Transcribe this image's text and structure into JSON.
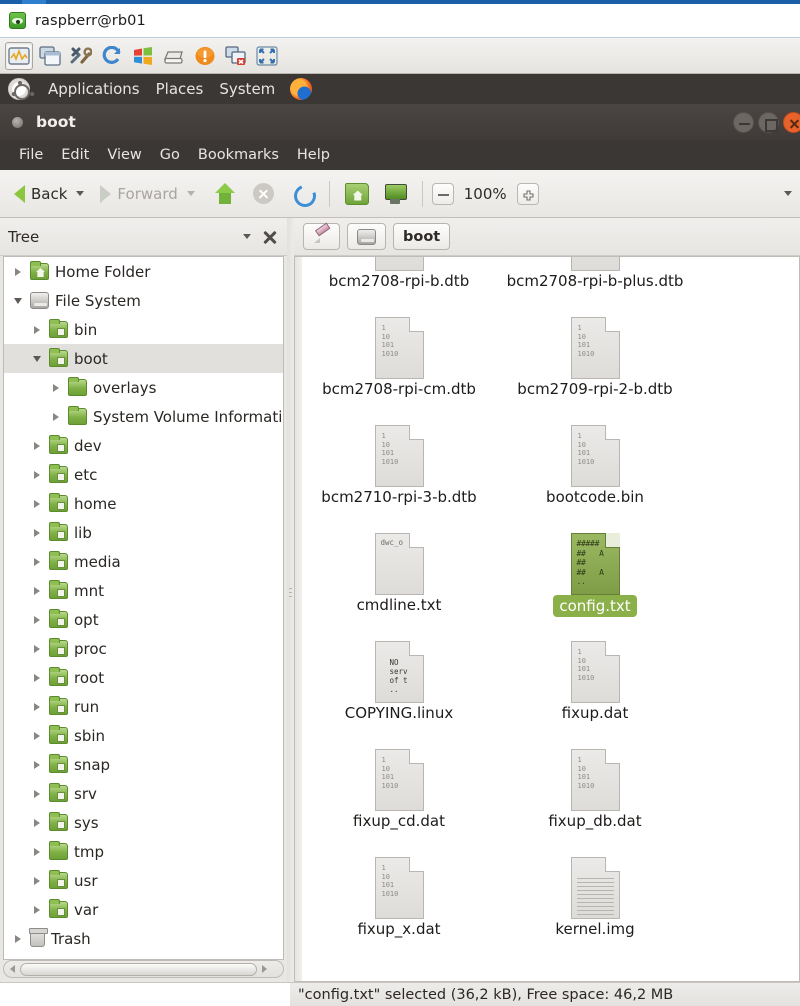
{
  "vnc": {
    "window_title": "raspberr@rb01",
    "icon": "vnc-eye-icon",
    "toolbar": [
      {
        "name": "connection-options-icon",
        "label": "Connection options"
      },
      {
        "name": "new-window-icon",
        "label": "New window"
      },
      {
        "name": "tools-icon",
        "label": "Options"
      },
      {
        "name": "refresh-icon",
        "label": "Refresh screen"
      },
      {
        "name": "send-ctrl-alt-del-icon",
        "label": "Send Ctrl-Alt-Del"
      },
      {
        "name": "file-transfer-icon",
        "label": "Transfer files"
      },
      {
        "name": "info-icon",
        "label": "Connection info"
      },
      {
        "name": "disconnect-icon",
        "label": "Disconnect"
      },
      {
        "name": "fullscreen-icon",
        "label": "Full screen"
      }
    ]
  },
  "gnome_panel": {
    "logo": "ubuntu-logo-icon",
    "menus": [
      "Applications",
      "Places",
      "System"
    ],
    "launchers": [
      {
        "name": "firefox-icon",
        "label": "Firefox"
      }
    ]
  },
  "nautilus": {
    "title": "boot",
    "menubar": [
      "File",
      "Edit",
      "View",
      "Go",
      "Bookmarks",
      "Help"
    ],
    "window_controls": [
      {
        "name": "minimize-button",
        "label": "Minimize"
      },
      {
        "name": "maximize-button",
        "label": "Maximize"
      },
      {
        "name": "close-button",
        "label": "Close"
      }
    ],
    "nav": {
      "back_label": "Back",
      "forward_label": "Forward",
      "up_label": "Up",
      "stop_label": "Stop",
      "reload_label": "Reload",
      "home_label": "Home",
      "computer_label": "Computer",
      "zoom_out_label": "Zoom out",
      "zoom_level": "100%",
      "zoom_in_label": "Zoom in"
    },
    "path_bar": {
      "edit_label": "Toggle location entry",
      "root_label": "File System",
      "crumbs": [
        "boot"
      ]
    },
    "status": "\"config.txt\" selected (36,2 kB), Free space: 46,2 MB"
  },
  "tree": {
    "header_title": "Tree",
    "items": [
      {
        "label": "Home Folder",
        "indent": 0,
        "state": "collapsed",
        "icon": "home-folder-icon",
        "selected": false
      },
      {
        "label": "File System",
        "indent": 0,
        "state": "expanded",
        "icon": "drive-icon",
        "selected": false
      },
      {
        "label": "bin",
        "indent": 1,
        "state": "collapsed",
        "icon": "folder-icon",
        "selected": false
      },
      {
        "label": "boot",
        "indent": 1,
        "state": "expanded",
        "icon": "folder-icon",
        "selected": true
      },
      {
        "label": "overlays",
        "indent": 2,
        "state": "collapsed",
        "icon": "folder-plain-icon",
        "selected": false
      },
      {
        "label": "System Volume Informati",
        "indent": 2,
        "state": "collapsed",
        "icon": "folder-plain-icon",
        "selected": false
      },
      {
        "label": "dev",
        "indent": 1,
        "state": "collapsed",
        "icon": "folder-icon",
        "selected": false
      },
      {
        "label": "etc",
        "indent": 1,
        "state": "collapsed",
        "icon": "folder-icon",
        "selected": false
      },
      {
        "label": "home",
        "indent": 1,
        "state": "collapsed",
        "icon": "folder-icon",
        "selected": false
      },
      {
        "label": "lib",
        "indent": 1,
        "state": "collapsed",
        "icon": "folder-icon",
        "selected": false
      },
      {
        "label": "media",
        "indent": 1,
        "state": "collapsed",
        "icon": "folder-icon",
        "selected": false
      },
      {
        "label": "mnt",
        "indent": 1,
        "state": "collapsed",
        "icon": "folder-icon",
        "selected": false
      },
      {
        "label": "opt",
        "indent": 1,
        "state": "collapsed",
        "icon": "folder-icon",
        "selected": false
      },
      {
        "label": "proc",
        "indent": 1,
        "state": "collapsed",
        "icon": "folder-icon",
        "selected": false
      },
      {
        "label": "root",
        "indent": 1,
        "state": "collapsed",
        "icon": "folder-icon",
        "selected": false
      },
      {
        "label": "run",
        "indent": 1,
        "state": "collapsed",
        "icon": "folder-icon",
        "selected": false
      },
      {
        "label": "sbin",
        "indent": 1,
        "state": "collapsed",
        "icon": "folder-icon",
        "selected": false
      },
      {
        "label": "snap",
        "indent": 1,
        "state": "collapsed",
        "icon": "folder-icon",
        "selected": false
      },
      {
        "label": "srv",
        "indent": 1,
        "state": "collapsed",
        "icon": "folder-icon",
        "selected": false
      },
      {
        "label": "sys",
        "indent": 1,
        "state": "collapsed",
        "icon": "folder-icon",
        "selected": false
      },
      {
        "label": "tmp",
        "indent": 1,
        "state": "collapsed",
        "icon": "folder-plain-icon",
        "selected": false
      },
      {
        "label": "usr",
        "indent": 1,
        "state": "collapsed",
        "icon": "folder-icon",
        "selected": false
      },
      {
        "label": "var",
        "indent": 1,
        "state": "collapsed",
        "icon": "folder-icon",
        "selected": false
      },
      {
        "label": "Trash",
        "indent": 0,
        "state": "collapsed",
        "icon": "trash-icon",
        "selected": false
      }
    ]
  },
  "files": {
    "icon_bits": "1\n10\n101\n1010",
    "items": [
      {
        "name": "bcm2708-rpi-b.dtb",
        "icon": "binary-file-icon",
        "selected": false,
        "col": 0,
        "row": 0
      },
      {
        "name": "bcm2708-rpi-b-plus.dtb",
        "icon": "binary-file-icon",
        "selected": false,
        "col": 1,
        "row": 0
      },
      {
        "name": "bcm2708-rpi-cm.dtb",
        "icon": "binary-file-icon",
        "selected": false,
        "col": 0,
        "row": 1
      },
      {
        "name": "bcm2709-rpi-2-b.dtb",
        "icon": "binary-file-icon",
        "selected": false,
        "col": 1,
        "row": 1
      },
      {
        "name": "bcm2710-rpi-3-b.dtb",
        "icon": "binary-file-icon",
        "selected": false,
        "col": 0,
        "row": 2
      },
      {
        "name": "bootcode.bin",
        "icon": "binary-file-icon",
        "selected": false,
        "col": 1,
        "row": 2
      },
      {
        "name": "cmdline.txt",
        "icon": "text-file-icon",
        "selected": false,
        "col": 0,
        "row": 3,
        "preview": "dwc_o"
      },
      {
        "name": "config.txt",
        "icon": "config-text-file-icon",
        "selected": true,
        "col": 1,
        "row": 3
      },
      {
        "name": "COPYING.linux",
        "icon": "license-file-icon",
        "selected": false,
        "col": 0,
        "row": 4,
        "preview": "NO\nserv\nof t"
      },
      {
        "name": "fixup.dat",
        "icon": "binary-file-icon",
        "selected": false,
        "col": 1,
        "row": 4
      },
      {
        "name": "fixup_cd.dat",
        "icon": "binary-file-icon",
        "selected": false,
        "col": 0,
        "row": 5
      },
      {
        "name": "fixup_db.dat",
        "icon": "binary-file-icon",
        "selected": false,
        "col": 1,
        "row": 5
      },
      {
        "name": "fixup_x.dat",
        "icon": "binary-file-icon",
        "selected": false,
        "col": 0,
        "row": 6
      },
      {
        "name": "kernel.img",
        "icon": "document-file-icon",
        "selected": false,
        "col": 1,
        "row": 6
      }
    ]
  },
  "colors": {
    "selection_green": "#8bb04a",
    "panel_dark": "#3b3735",
    "titlebar_dark": "#443f3d",
    "accent_orange": "#e8622c"
  }
}
